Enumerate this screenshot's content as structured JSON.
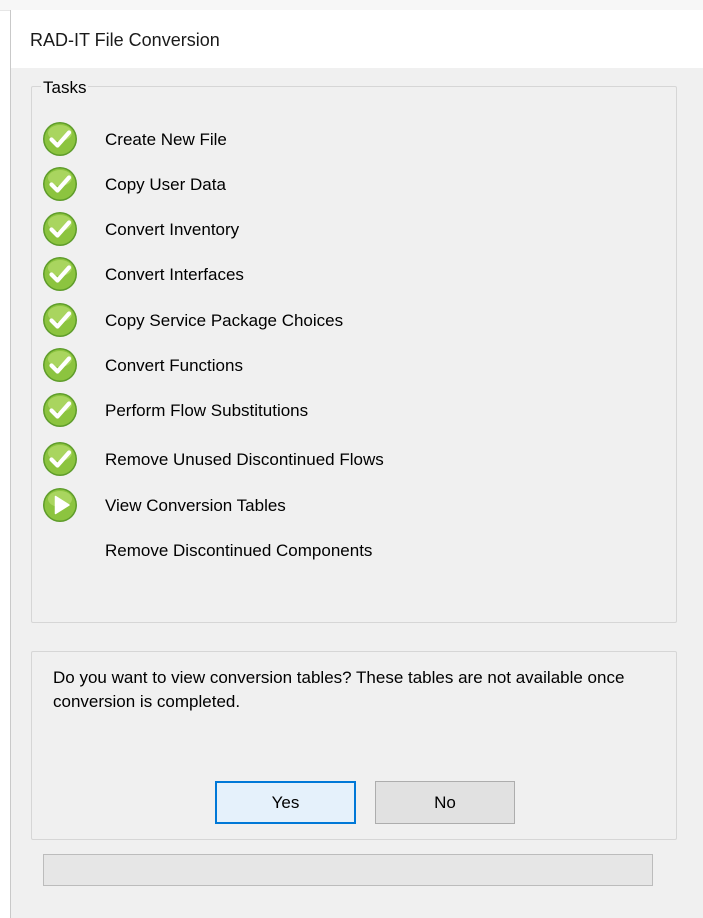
{
  "window": {
    "title": "RAD-IT File Conversion"
  },
  "tasks_group": {
    "legend": "Tasks",
    "items": [
      {
        "label": "Create New File",
        "status": "done",
        "icon": "check-icon"
      },
      {
        "label": "Copy User Data",
        "status": "done",
        "icon": "check-icon"
      },
      {
        "label": "Convert Inventory",
        "status": "done",
        "icon": "check-icon"
      },
      {
        "label": "Convert Interfaces",
        "status": "done",
        "icon": "check-icon"
      },
      {
        "label": "Copy Service Package Choices",
        "status": "done",
        "icon": "check-icon"
      },
      {
        "label": "Convert Functions",
        "status": "done",
        "icon": "check-icon"
      },
      {
        "label": "Perform Flow Substitutions",
        "status": "done",
        "icon": "check-icon"
      },
      {
        "label": "Remove Unused Discontinued Flows",
        "status": "done",
        "icon": "check-icon"
      },
      {
        "label": "View Conversion Tables",
        "status": "current",
        "icon": "play-arrow-icon"
      },
      {
        "label": "Remove Discontinued Components",
        "status": "pending",
        "icon": ""
      }
    ]
  },
  "prompt": {
    "message": "Do you want to view conversion tables?  These tables are not available once conversion is completed.",
    "yes_label": "Yes",
    "no_label": "No"
  },
  "progress": {
    "value": 0
  },
  "colors": {
    "icon_green_light": "#a6d15a",
    "icon_green_dark": "#4c8a1e",
    "accent_focus": "#0078d7",
    "dialog_bg": "#f0f0f0"
  }
}
